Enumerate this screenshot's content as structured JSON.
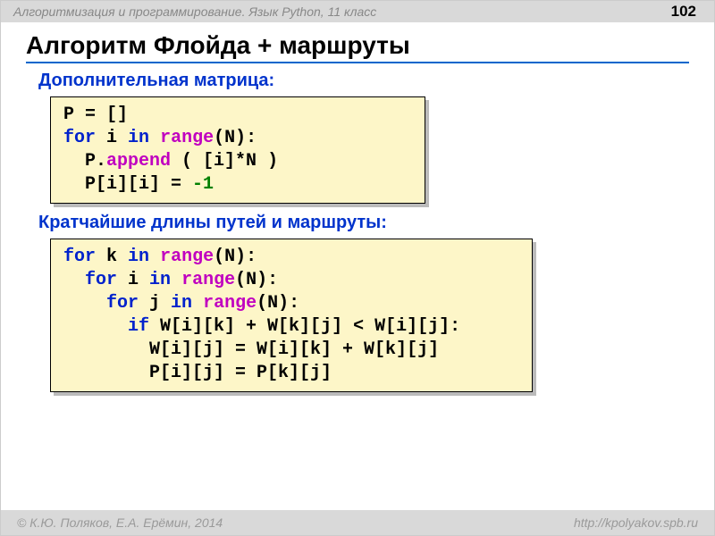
{
  "header": {
    "course": "Алгоритмизация и программирование. Язык Python, 11 класс",
    "page_number": "102"
  },
  "title": "Алгоритм Флойда + маршруты",
  "section1": {
    "label": "Дополнительная матрица:",
    "code": {
      "l1a": "P = []",
      "l2_kw1": "for",
      "l2_a": " i ",
      "l2_kw2": "in",
      "l2_b": " ",
      "l2_fn": "range",
      "l2_c": "(N):",
      "l3_a": "  P",
      "l3_dot": ".",
      "l3_fn": "append",
      "l3_b": " ( [i]*N )",
      "l4_a": "  P[i][i] = ",
      "l4_num": "-1"
    }
  },
  "section2": {
    "label": "Кратчайшие длины путей и маршруты:",
    "code": {
      "l1_kw1": "for",
      "l1_a": " k ",
      "l1_kw2": "in",
      "l1_b": " ",
      "l1_fn": "range",
      "l1_c": "(N):",
      "l2_pad": "  ",
      "l2_kw1": "for",
      "l2_a": " i ",
      "l2_kw2": "in",
      "l2_b": " ",
      "l2_fn": "range",
      "l2_c": "(N):",
      "l3_pad": "    ",
      "l3_kw1": "for",
      "l3_a": " j ",
      "l3_kw2": "in",
      "l3_b": " ",
      "l3_fn": "range",
      "l3_c": "(N):",
      "l4_pad": "      ",
      "l4_kw": "if",
      "l4_a": " W[i][k] + W[k][j] < W[i][j]:",
      "l5": "        W[i][j] = W[i][k] + W[k][j]",
      "l6": "        P[i][j] = P[k][j]"
    }
  },
  "footer": {
    "authors": "© К.Ю. Поляков, Е.А. Ерёмин, 2014",
    "url": "http://kpolyakov.spb.ru"
  }
}
